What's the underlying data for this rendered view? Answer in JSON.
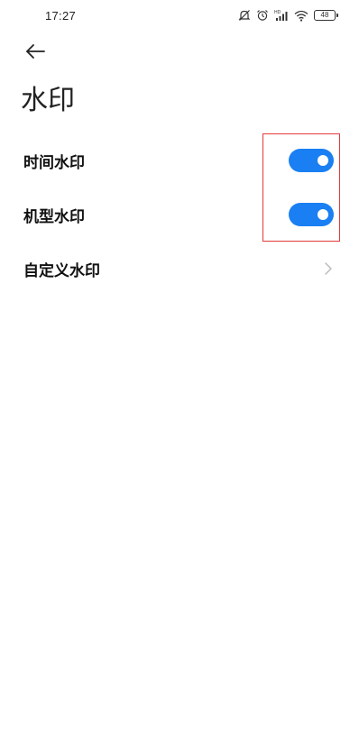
{
  "status_bar": {
    "time": "17:27",
    "icons": [
      "mute-icon",
      "alarm-icon",
      "signal-icon",
      "wifi-icon",
      "battery-icon"
    ],
    "signal_label": "HD",
    "battery_level": "48"
  },
  "header": {
    "back_icon": "arrow-left-icon",
    "title": "水印"
  },
  "settings": [
    {
      "label": "时间水印",
      "control": "toggle",
      "enabled": true
    },
    {
      "label": "机型水印",
      "control": "toggle",
      "enabled": true
    },
    {
      "label": "自定义水印",
      "control": "chevron",
      "icon": "chevron-right-icon"
    }
  ],
  "colors": {
    "toggle_on": "#1a7ff2",
    "highlight_border": "#e23b3b",
    "background": "#ffffff"
  }
}
